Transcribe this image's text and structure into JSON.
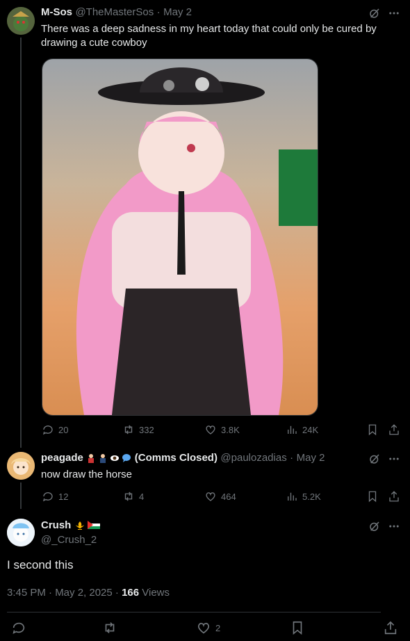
{
  "tweet1": {
    "display_name": "M-Sos",
    "handle": "@TheMasterSos",
    "date": "May 2",
    "text": "There was a deep sadness in my heart today that could only be cured by drawing a cute cowboy",
    "stats": {
      "replies": "20",
      "reposts": "332",
      "likes": "3.8K",
      "views": "24K"
    },
    "media_alt": "Illustration of a pink-haired girl in a black cowboy hat"
  },
  "tweet2": {
    "display_name": "peagade",
    "name_suffix": "(Comms Closed)",
    "handle": "@paulozadias",
    "date": "May 2",
    "text": "now draw the horse",
    "stats": {
      "replies": "12",
      "reposts": "4",
      "likes": "464",
      "views": "5.2K"
    }
  },
  "main": {
    "display_name": "Crush",
    "handle": "@_Crush_2",
    "text": "I second this",
    "timestamp": "3:45 PM · May 2, 2025 · ",
    "views_count": "166",
    "views_label": " Views",
    "likes": "2"
  },
  "separator": "·",
  "icons": [
    "grok-icon",
    "more-icon",
    "reply-icon",
    "repost-icon",
    "like-icon",
    "views-icon",
    "bookmark-icon",
    "share-icon"
  ],
  "colors": {
    "background": "#000000",
    "text": "#e7e9ea",
    "muted": "#71767b",
    "border": "#2f3336"
  }
}
